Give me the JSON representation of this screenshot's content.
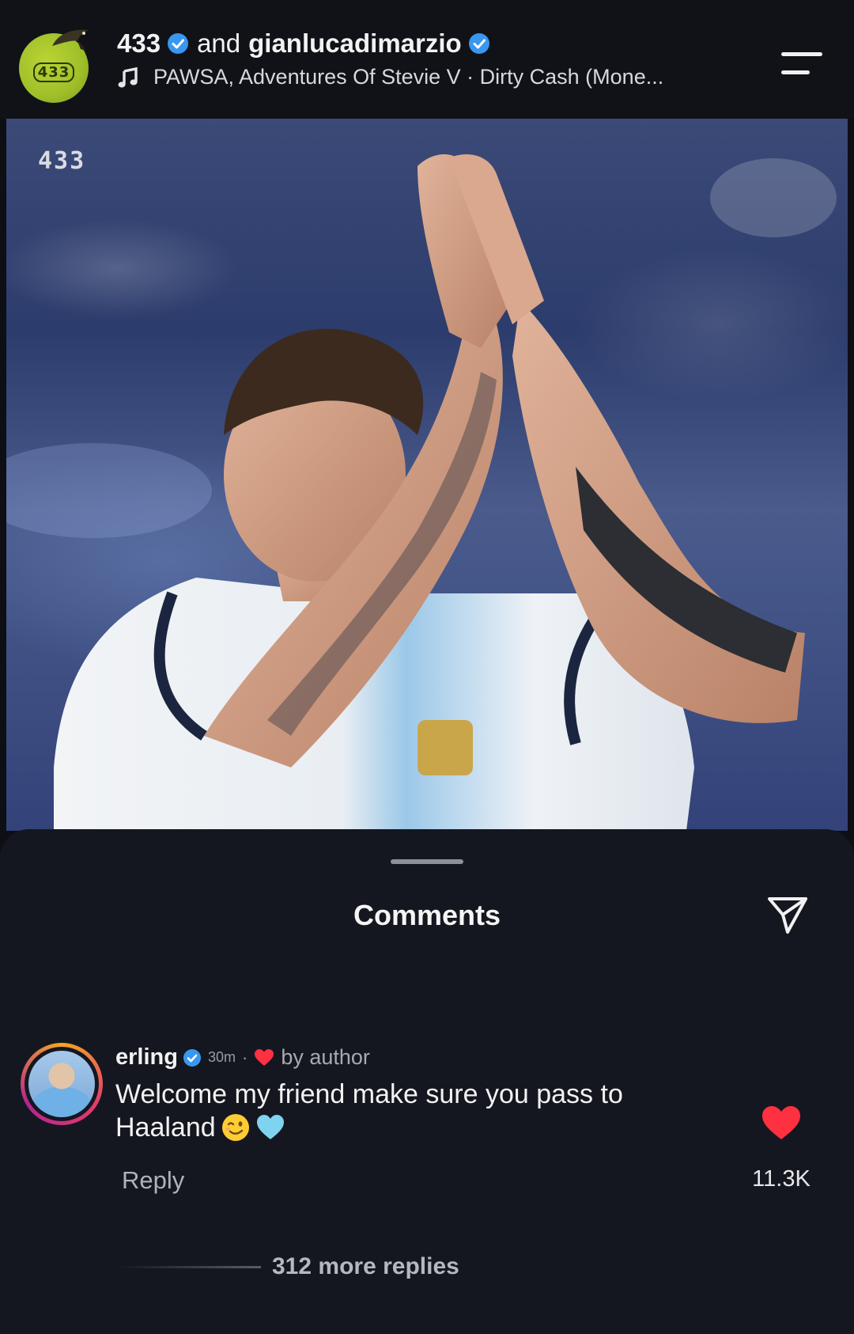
{
  "header": {
    "account_primary": "433",
    "connector": "and",
    "account_secondary": "gianlucadimarzio",
    "audio_track": "PAWSA, Adventures Of Stevie V · Dirty Cash (Mone...",
    "avatar_logo_text": "433",
    "icons": {
      "verified": "verified-badge-icon",
      "music": "music-note-icon",
      "menu": "menu-icon"
    }
  },
  "media": {
    "watermark": "433"
  },
  "comments_sheet": {
    "title": "Comments",
    "share_icon": "send-icon",
    "comments": [
      {
        "username": "erling",
        "verified": true,
        "timestamp": "30m",
        "separator": "·",
        "author_badge": "by author",
        "text": "Welcome my friend make sure you pass to Haaland",
        "emojis": [
          "winking-face-emoji",
          "light-blue-heart-emoji"
        ],
        "reply_label": "Reply",
        "like_count": "11.3K",
        "liked": true,
        "more_replies": "312 more replies"
      }
    ]
  },
  "colors": {
    "background": "#0e0f14",
    "sheet": "#151720",
    "verified_blue": "#3897f0",
    "like_red": "#ff3040",
    "logo_green": "#9fbf2a"
  }
}
